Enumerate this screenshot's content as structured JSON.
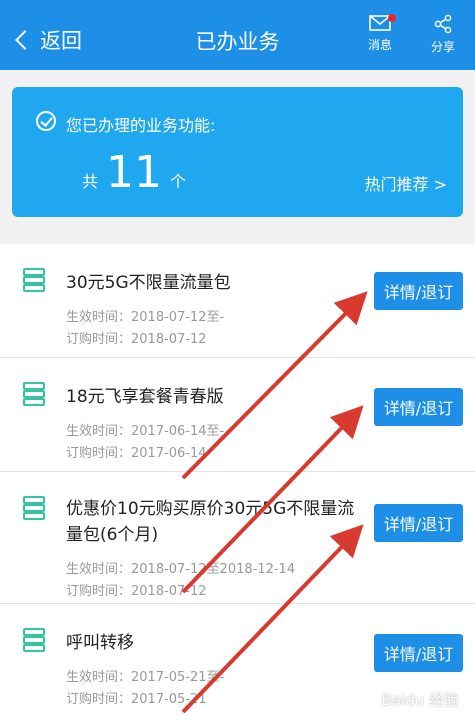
{
  "header": {
    "back_label": "返回",
    "title": "已办业务",
    "message_label": "消息",
    "share_label": "分享",
    "background": "#1e8fe6",
    "badge_color": "#e8262b"
  },
  "summary": {
    "title": "您已办理的业务功能:",
    "count_prefix": "共",
    "count": "11",
    "count_suffix": "个",
    "hot_link": "热门推荐 >",
    "background": "#1fa7ef"
  },
  "items": [
    {
      "name": "30元5G不限量流量包",
      "effective": "生效时间：2018-07-12至-",
      "ordered": "订购时间：2018-07-12",
      "button": "详情/退订"
    },
    {
      "name": "18元飞享套餐青春版",
      "effective": "生效时间：2017-06-14至-",
      "ordered": "订购时间：2017-06-14",
      "button": "详情/退订"
    },
    {
      "name": "优惠价10元购买原价30元5G不限量流量包(6个月)",
      "name_line1": "优惠价10元购买原价30元5G不限量流",
      "name_line2": "量包(6个月)",
      "effective": "生效时间：2018-07-12至2018-12-14",
      "ordered": "订购时间：2018-07-12",
      "button": "详情/退订"
    },
    {
      "name": "呼叫转移",
      "effective": "生效时间：2017-05-21至-",
      "ordered": "订购时间：2017-05-21",
      "button": "详情/退订"
    }
  ],
  "watermark": "Baidu 经验",
  "icons": {
    "back": "chevron-left-icon",
    "message": "envelope-icon",
    "share": "share-icon",
    "check": "check-circle-icon",
    "service": "layers-icon"
  },
  "annotation_color": "#d93a30"
}
